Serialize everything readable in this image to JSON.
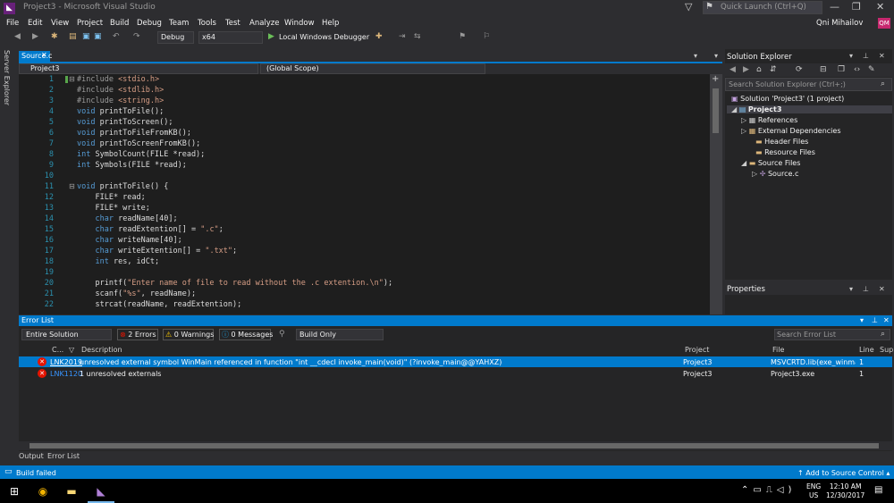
{
  "window": {
    "title": "Project3 - Microsoft Visual Studio",
    "logo": "vs-logo"
  },
  "quick_launch": {
    "placeholder": "Quick Launch (Ctrl+Q)"
  },
  "menu": [
    "File",
    "Edit",
    "View",
    "Project",
    "Build",
    "Debug",
    "Team",
    "Tools",
    "Test",
    "Analyze",
    "Window",
    "Help"
  ],
  "user": {
    "name": "Qni Mihailov",
    "initials": "QM"
  },
  "toolbar": {
    "config": "Debug",
    "platform": "x64",
    "debugger": "Local Windows Debugger"
  },
  "side_tab": {
    "label": "Server Explorer"
  },
  "editor": {
    "tab": "Source.c",
    "nav_project": "Project3",
    "nav_scope": "(Global Scope)",
    "lines": [
      {
        "n": "1",
        "text": "#include <stdio.h>"
      },
      {
        "n": "2",
        "text": "#include <stdlib.h>"
      },
      {
        "n": "3",
        "text": "#include <string.h>"
      },
      {
        "n": "4",
        "text": "void printToFile();"
      },
      {
        "n": "5",
        "text": "void printToScreen();"
      },
      {
        "n": "6",
        "text": "void printToFileFromKB();"
      },
      {
        "n": "7",
        "text": "void printToScreenFromKB();"
      },
      {
        "n": "8",
        "text": "int SymbolCount(FILE *read);"
      },
      {
        "n": "9",
        "text": "int Symbols(FILE *read);"
      },
      {
        "n": "10",
        "text": ""
      },
      {
        "n": "11",
        "text": "void printToFile() {"
      },
      {
        "n": "12",
        "text": "    FILE* read;"
      },
      {
        "n": "13",
        "text": "    FILE* write;"
      },
      {
        "n": "14",
        "text": "    char readName[40];"
      },
      {
        "n": "15",
        "text": "    char readExtention[] = \".c\";"
      },
      {
        "n": "16",
        "text": "    char writeName[40];"
      },
      {
        "n": "17",
        "text": "    char writeExtention[] = \".txt\";"
      },
      {
        "n": "18",
        "text": "    int res, idCt;"
      },
      {
        "n": "19",
        "text": ""
      },
      {
        "n": "20",
        "text": "    printf(\"Enter name of file to read without the .c extention.\\n\");"
      },
      {
        "n": "21",
        "text": "    scanf(\"%s\", readName);"
      },
      {
        "n": "22",
        "text": "    strcat(readName, readExtention);"
      }
    ]
  },
  "solution_explorer": {
    "title": "Solution Explorer",
    "search_placeholder": "Search Solution Explorer (Ctrl+;)",
    "items": [
      {
        "label": "Solution 'Project3' (1 project)",
        "icon": "solution-icon"
      },
      {
        "label": "Project3",
        "icon": "project-icon"
      },
      {
        "label": "References",
        "icon": "references-icon"
      },
      {
        "label": "External Dependencies",
        "icon": "dependencies-icon"
      },
      {
        "label": "Header Files",
        "icon": "folder-icon"
      },
      {
        "label": "Resource Files",
        "icon": "folder-icon"
      },
      {
        "label": "Source Files",
        "icon": "folder-open-icon"
      },
      {
        "label": "Source.c",
        "icon": "c-file-icon"
      }
    ]
  },
  "properties": {
    "title": "Properties"
  },
  "error_list": {
    "title": "Error List",
    "scope": "Entire Solution",
    "errors_filter": "2 Errors",
    "warnings_filter": "0 Warnings",
    "messages_filter": "0 Messages",
    "build_filter": "Build Only",
    "search_placeholder": "Search Error List",
    "columns": {
      "code": "C...",
      "description": "Description",
      "project": "Project",
      "file": "File",
      "line": "Line",
      "suppression": "Sup"
    },
    "rows": [
      {
        "code": "LNK2019",
        "description": "unresolved external symbol WinMain referenced in function \"int __cdecl invoke_main(void)\" (?invoke_main@@YAHXZ)",
        "project": "Project3",
        "file": "MSVCRTD.lib(exe_winmai...",
        "line": "1"
      },
      {
        "code": "LNK1120",
        "description": "1 unresolved externals",
        "project": "Project3",
        "file": "Project3.exe",
        "line": "1"
      }
    ]
  },
  "bottom_tabs": [
    "Output",
    "Error List"
  ],
  "status": {
    "text": "Build failed",
    "source_control": "Add to Source Control"
  },
  "taskbar": {
    "lang1": "ENG",
    "lang2": "US",
    "time": "12:10 AM",
    "date": "12/30/2017"
  },
  "colors": {
    "accent": "#007acc",
    "error": "#e51400",
    "background": "#2d2d30",
    "editor": "#1e1e1e"
  }
}
